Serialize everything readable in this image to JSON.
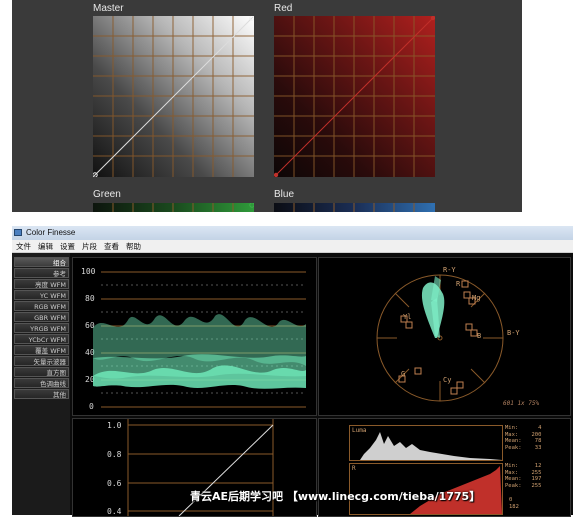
{
  "curves_panel": {
    "master_title": "Master",
    "red_title": "Red",
    "green_title": "Green",
    "blue_title": "Blue"
  },
  "window": {
    "title": "Color Finesse"
  },
  "menu": {
    "items": [
      "文件",
      "编辑",
      "设置",
      "片段",
      "查看",
      "帮助"
    ]
  },
  "sidebar": {
    "items": [
      {
        "label": "组合",
        "active": true
      },
      {
        "label": "参考",
        "active": false
      },
      {
        "label": "亮度 WFM",
        "active": false
      },
      {
        "label": "YC WFM",
        "active": false
      },
      {
        "label": "RGB WFM",
        "active": false
      },
      {
        "label": "GBR WFM",
        "active": false
      },
      {
        "label": "YRGB WFM",
        "active": false
      },
      {
        "label": "YCbCr WFM",
        "active": false
      },
      {
        "label": "覆盖 WFM",
        "active": false
      },
      {
        "label": "矢量示波器",
        "active": false
      },
      {
        "label": "直方图",
        "active": false
      },
      {
        "label": "色调曲线",
        "active": false
      },
      {
        "label": "其他",
        "active": false
      }
    ]
  },
  "waveform": {
    "ticks": [
      "100",
      "80",
      "60",
      "40",
      "20",
      "0"
    ]
  },
  "vectorscope": {
    "labels": {
      "r_y": "R-Y",
      "b_y": "B-Y",
      "mg": "Mg",
      "yl": "Yl",
      "cy": "Cy",
      "r": "R",
      "g": "G",
      "b": "B"
    },
    "footnote": "601 1x 75%"
  },
  "curve_bottom": {
    "ticks": [
      "1.0",
      "0.8",
      "0.6",
      "0.4"
    ]
  },
  "histogram": {
    "luma": {
      "label": "Luma",
      "stats": "Min:      4\nMax:    200\nMean:    78\nPeak:    33"
    },
    "red": {
      "label": "R",
      "stats": "Min:     12\nMax:    255\nMean:   197\nPeak:   255"
    },
    "red_extra": "0\n182"
  },
  "watermark": "青云AE后期学习吧  【www.linecg.com/tieba/1775】",
  "colors": {
    "grid": "#8a5a2a",
    "waveform_trace": "#6fe8b8",
    "vector_trace": "#7ff0c8",
    "red_curve": "#c0302a",
    "green_curve": "#2f9a3a",
    "blue_curve": "#2f6fb0"
  }
}
